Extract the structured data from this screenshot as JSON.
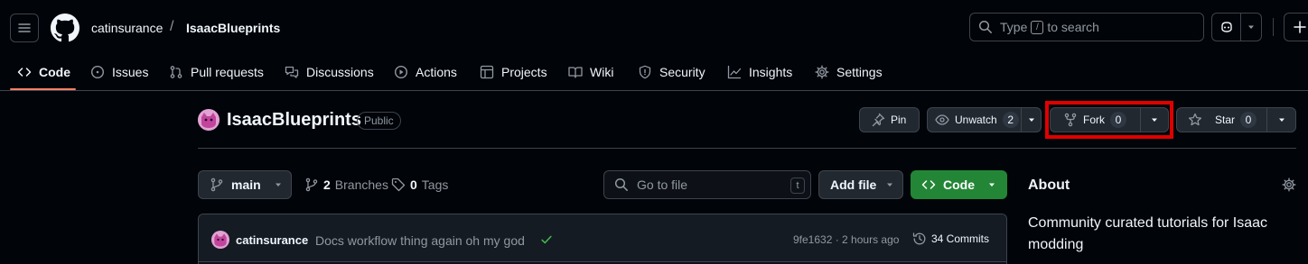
{
  "header": {
    "owner": "catinsurance",
    "separator": "/",
    "repo": "IsaacBlueprints",
    "search_prefix": "Type",
    "search_key": "/",
    "search_suffix": "to search"
  },
  "tabs": [
    {
      "label": "Code",
      "icon": "code-icon",
      "active": true
    },
    {
      "label": "Issues",
      "icon": "issue-opened-icon"
    },
    {
      "label": "Pull requests",
      "icon": "git-pull-request-icon"
    },
    {
      "label": "Discussions",
      "icon": "comment-discussion-icon"
    },
    {
      "label": "Actions",
      "icon": "play-icon"
    },
    {
      "label": "Projects",
      "icon": "table-icon"
    },
    {
      "label": "Wiki",
      "icon": "book-icon"
    },
    {
      "label": "Security",
      "icon": "shield-icon"
    },
    {
      "label": "Insights",
      "icon": "graph-icon"
    },
    {
      "label": "Settings",
      "icon": "gear-icon"
    }
  ],
  "repo": {
    "name": "IsaacBlueprints",
    "visibility": "Public",
    "pin_label": "Pin",
    "watch_label": "Unwatch",
    "watch_count": "2",
    "fork_label": "Fork",
    "fork_count": "0",
    "star_label": "Star",
    "star_count": "0"
  },
  "filenav": {
    "branch": "main",
    "branches_count": "2",
    "branches_label": "Branches",
    "tags_count": "0",
    "tags_label": "Tags",
    "goto_placeholder": "Go to file",
    "goto_key": "t",
    "add_file_label": "Add file",
    "code_label": "Code"
  },
  "commit": {
    "author": "catinsurance",
    "message": "Docs workflow thing again oh my god",
    "sha_time": "9fe1632 · 2 hours ago",
    "commits_label": "34 Commits"
  },
  "about": {
    "title": "About",
    "description": "Community curated tutorials for Isaac modding"
  },
  "colors": {
    "background": "#010409",
    "border": "#3d444d",
    "accent_underline": "#f78166",
    "code_button": "#238636",
    "highlight_box": "#e00000",
    "success": "#3fb950"
  }
}
